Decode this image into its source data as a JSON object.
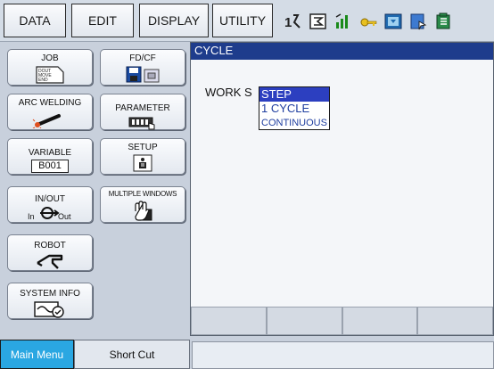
{
  "top_menu": {
    "data": "DATA",
    "edit": "EDIT",
    "display": "DISPLAY",
    "utility": "UTILITY"
  },
  "main_menu": {
    "job": {
      "label": "JOB",
      "icon_text": "DOUT MOVE END"
    },
    "fdcf": {
      "label": "FD/CF"
    },
    "arc_welding": {
      "label": "ARC WELDING"
    },
    "parameter": {
      "label": "PARAMETER"
    },
    "variable": {
      "label": "VARIABLE",
      "value": "B001"
    },
    "setup": {
      "label": "SETUP"
    },
    "inout": {
      "label": "IN/OUT",
      "in": "In",
      "out": "Out"
    },
    "multiple_windows": {
      "label": "MULTIPLE WINDOWS"
    },
    "robot": {
      "label": "ROBOT"
    },
    "system_info": {
      "label": "SYSTEM INFO"
    }
  },
  "content": {
    "title": "CYCLE",
    "work_label": "WORK S",
    "dropdown": {
      "options": [
        "STEP",
        "1 CYCLE",
        "CONTINUOUS"
      ],
      "selected": "STEP"
    }
  },
  "bottom": {
    "main_menu": "Main Menu",
    "short_cut": "Short Cut"
  },
  "status_icons": [
    "robot-arm-icon",
    "coordinate-icon",
    "speed-icon",
    "key-icon",
    "teach-mode-icon",
    "page-icon",
    "play-icon"
  ],
  "colors": {
    "title_bar": "#1e3c8c",
    "main_menu_tab": "#2aa7e2",
    "dropdown_selected": "#2c3fc0"
  }
}
